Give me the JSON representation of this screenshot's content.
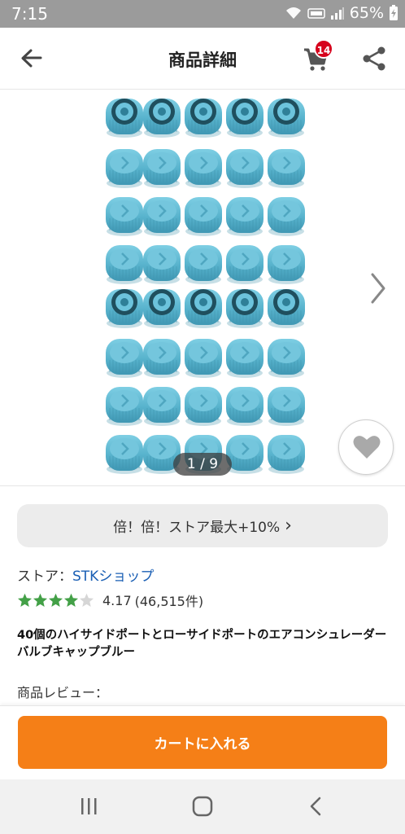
{
  "status_bar": {
    "time": "7:15",
    "battery": "65%",
    "icons": [
      "wifi-icon",
      "volte-icon",
      "signal-icon",
      "battery-icon"
    ]
  },
  "header": {
    "title": "商品詳細",
    "cart_count": "14",
    "icons": [
      "back-arrow-icon",
      "cart-icon",
      "share-icon"
    ]
  },
  "gallery": {
    "counter": "1 / 9",
    "icons": [
      "chevron-right-icon",
      "heart-icon"
    ]
  },
  "promo": {
    "label": "倍！倍！ストア最大+10%",
    "chevron": "›"
  },
  "store": {
    "prefix": "ストア：",
    "name": "STKショップ"
  },
  "rating": {
    "value": 4.17,
    "value_text": "4.17",
    "count_text": "(46,515件)"
  },
  "product": {
    "title": "40個のハイサイドポートとローサイドポートのエアコンシュレーダーバルブキャップブルー",
    "review_label": "商品レビュー："
  },
  "cart_button": {
    "label": "カートに入れる"
  },
  "colors": {
    "accent": "#f57f17",
    "badge": "#d6001c",
    "link": "#1a5fb4",
    "cap_blue": "#5fb6cf",
    "star": "#43a047"
  },
  "nav_bar": {
    "icons": [
      "recent-apps-icon",
      "home-icon",
      "back-icon"
    ]
  }
}
